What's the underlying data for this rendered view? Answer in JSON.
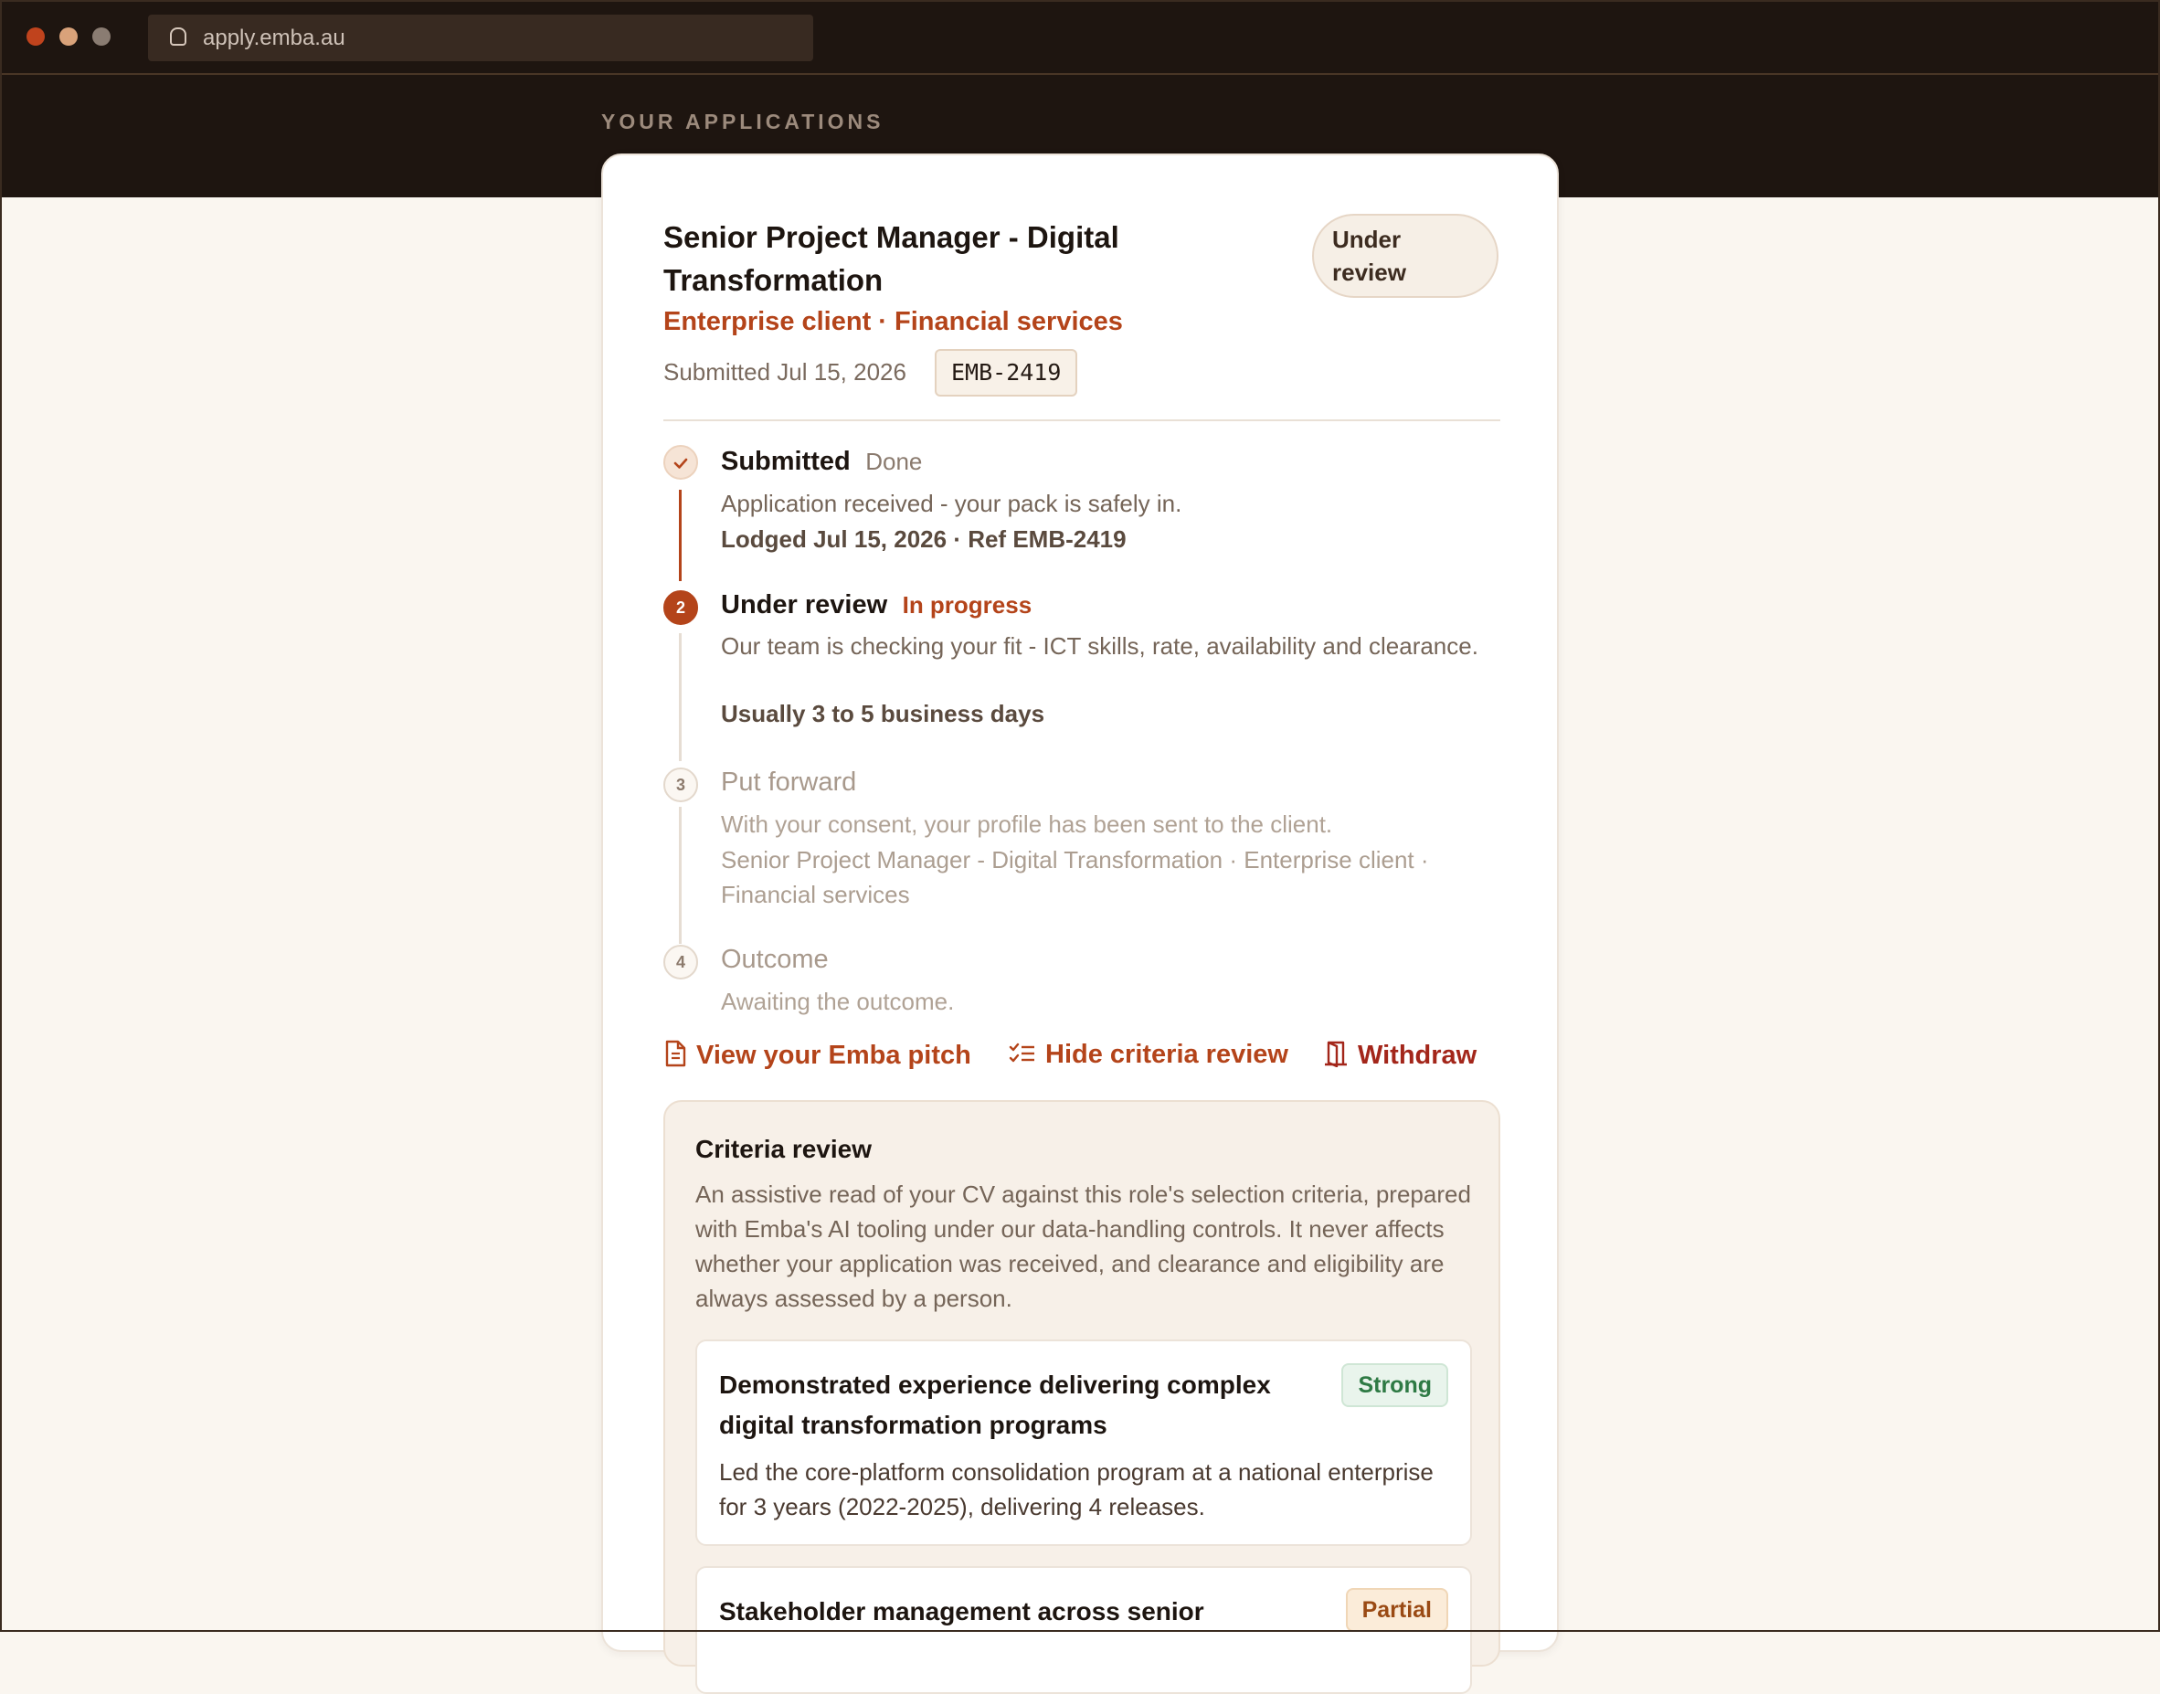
{
  "browser": {
    "url": "apply.emba.au"
  },
  "page": {
    "eyebrow": "YOUR APPLICATIONS"
  },
  "application": {
    "title": "Senior Project Manager - Digital Transformation",
    "status": "Under review",
    "client": "Enterprise client · Financial services",
    "submitted": "Submitted Jul 15, 2026",
    "reference": "EMB-2419"
  },
  "timeline": [
    {
      "number": "1",
      "title": "Submitted",
      "status": "Done",
      "description": "Application received - your pack is safely in.",
      "meta": "Lodged Jul 15, 2026 · Ref EMB-2419"
    },
    {
      "number": "2",
      "title": "Under review",
      "status": "In progress",
      "description": "Our team is checking your fit - ICT skills, rate, availability and clearance.",
      "meta": "Usually 3 to 5 business days"
    },
    {
      "number": "3",
      "title": "Put forward",
      "status": "",
      "description": "With your consent, your profile has been sent to the client.",
      "meta": "Senior Project Manager - Digital Transformation · Enterprise client · Financial services"
    },
    {
      "number": "4",
      "title": "Outcome",
      "status": "",
      "description": "Awaiting the outcome.",
      "meta": ""
    }
  ],
  "actions": {
    "view_pitch": "View your Emba pitch",
    "hide_review": "Hide criteria review",
    "withdraw": "Withdraw"
  },
  "criteria_review": {
    "title": "Criteria review",
    "description": "An assistive read of your CV against this role's selection criteria, prepared with Emba's AI tooling under our data-handling controls. It never affects whether your application was received, and clearance and eligibility are always assessed by a person.",
    "items": [
      {
        "criterion": "Demonstrated experience delivering complex digital transformation programs",
        "rating": "Strong",
        "evidence": "Led the core-platform consolidation program at a national enterprise for 3 years (2022-2025), delivering 4 releases."
      },
      {
        "criterion": "Stakeholder management across senior",
        "rating": "Partial",
        "evidence": ""
      }
    ]
  },
  "colors": {
    "accent": "#b4441a",
    "chrome": "#1e1510",
    "background": "#faf6f0",
    "strong": "#2e7a44",
    "withdraw": "#a3261a"
  },
  "icons": {
    "lock": "lock-icon",
    "check": "check-icon",
    "document": "document-icon",
    "checklist": "checklist-icon",
    "door": "door-exit-icon"
  }
}
